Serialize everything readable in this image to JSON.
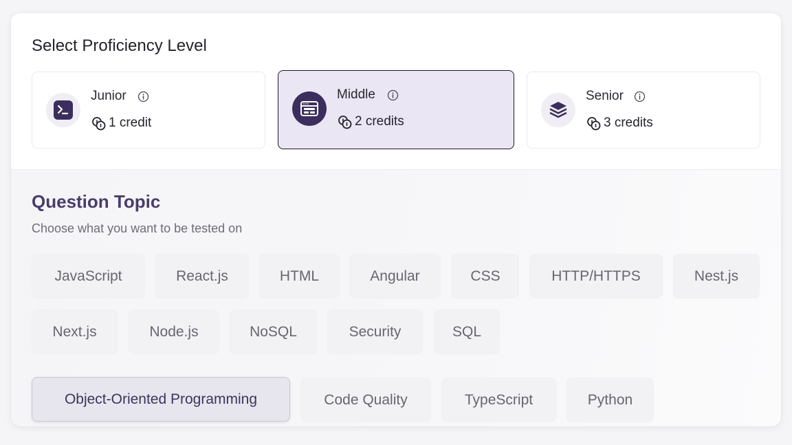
{
  "proficiency": {
    "title": "Select Proficiency Level",
    "levels": [
      {
        "name": "Junior",
        "credits": "1 credit",
        "icon": "terminal-icon",
        "selected": false
      },
      {
        "name": "Middle",
        "credits": "2 credits",
        "icon": "browser-window-icon",
        "selected": true
      },
      {
        "name": "Senior",
        "credits": "3 credits",
        "icon": "layers-stack-icon",
        "selected": false
      }
    ]
  },
  "topics": {
    "title": "Question Topic",
    "subtitle": "Choose what you want to be tested on",
    "items": [
      "JavaScript",
      "React.js",
      "HTML",
      "Angular",
      "CSS",
      "HTTP/HTTPS",
      "Nest.js",
      "Next.js",
      "Node.js",
      "NoSQL",
      "Security",
      "SQL",
      "Object-Oriented Programming",
      "Code Quality",
      "TypeScript",
      "Python"
    ],
    "selected": "Object-Oriented Programming"
  },
  "colors": {
    "accent": "#3c2e5c",
    "selected_card_bg": "#ebe6f4",
    "topic_title": "#4a3c6a"
  }
}
